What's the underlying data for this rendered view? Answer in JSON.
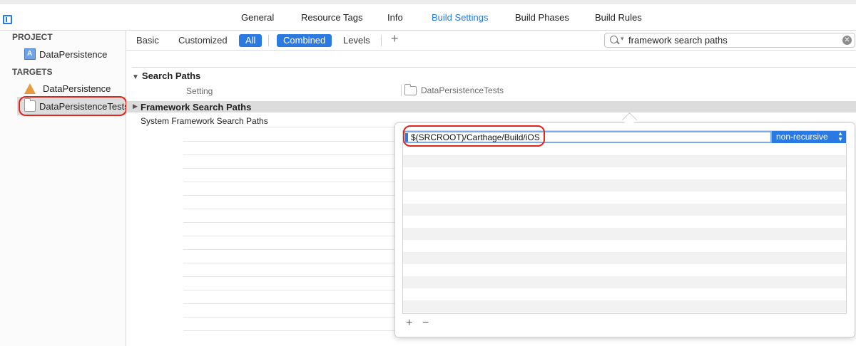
{
  "tabs": [
    {
      "label": "General",
      "active": false
    },
    {
      "label": "Resource Tags",
      "active": false
    },
    {
      "label": "Info",
      "active": false
    },
    {
      "label": "Build Settings",
      "active": true
    },
    {
      "label": "Build Phases",
      "active": false
    },
    {
      "label": "Build Rules",
      "active": false
    }
  ],
  "sidebar": {
    "project_header": "PROJECT",
    "project_item": "DataPersistence",
    "targets_header": "TARGETS",
    "targets": [
      "DataPersistence",
      "DataPersistenceTests"
    ],
    "selected_target": "DataPersistenceTests"
  },
  "filter_bar": {
    "basic": "Basic",
    "customized": "Customized",
    "all": "All",
    "combined": "Combined",
    "levels": "Levels",
    "add": "+",
    "search_value": "framework search paths"
  },
  "content": {
    "section_title": "Search Paths",
    "column_setting": "Setting",
    "column_target": "DataPersistenceTests",
    "rows": [
      "Framework Search Paths",
      "System Framework Search Paths"
    ]
  },
  "popover": {
    "path_value": "$(SRCROOT)/Carthage/Build/iOS",
    "recursion": "non-recursive",
    "add": "+",
    "remove": "−"
  },
  "colors": {
    "accent": "#2a7ae2",
    "highlight_ring": "#e2231a"
  },
  "icons": [
    "sidebar-toggle-icon",
    "project-icon",
    "app-target-icon",
    "test-bundle-icon",
    "search-icon",
    "clear-icon",
    "disclosure-triangle-icon"
  ]
}
